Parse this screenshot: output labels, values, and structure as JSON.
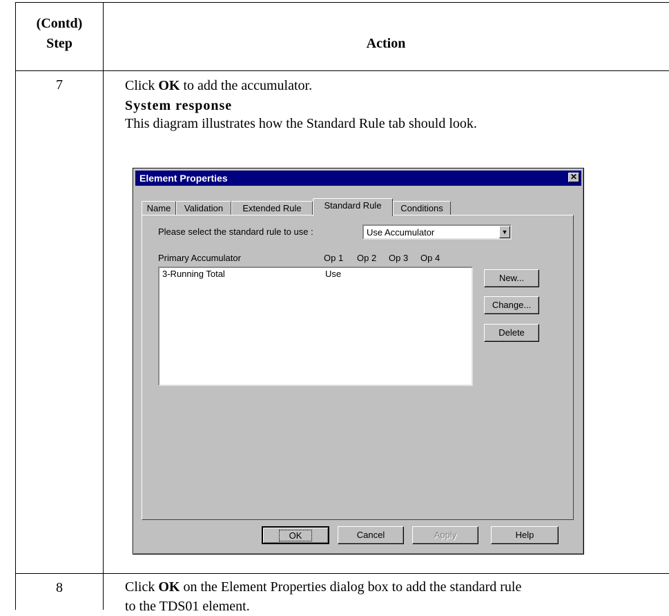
{
  "header": {
    "step_line1": "(Contd)",
    "step_line2": "Step",
    "action": "Action"
  },
  "rows": [
    {
      "step": "7",
      "instruction_pre": "Click ",
      "instruction_bold": "OK",
      "instruction_post": " to add the accumulator.",
      "response_heading": "System response",
      "response_text": "This diagram illustrates how the Standard Rule tab should look."
    },
    {
      "step": "8",
      "instruction_pre": "Click ",
      "instruction_bold": "OK",
      "instruction_post": " on the Element Properties dialog box to add the standard rule",
      "instruction_line2": "to the TDS01 element."
    }
  ],
  "dialog": {
    "title": "Element Properties",
    "close_glyph": "✕",
    "tabs": [
      "Name",
      "Validation",
      "Extended Rule",
      "Standard Rule",
      "Conditions"
    ],
    "active_tab": "Standard Rule",
    "select_label": "Please select the standard rule to use :",
    "rule_value": "Use Accumulator",
    "dropdown_glyph": "▼",
    "columns": [
      "Primary Accumulator",
      "Op 1",
      "Op 2",
      "Op 3",
      "Op 4"
    ],
    "accumulators": [
      {
        "name": "3-Running Total",
        "op1": "Use"
      }
    ],
    "side_buttons": [
      "New...",
      "Change...",
      "Delete"
    ],
    "footer_buttons": [
      "OK",
      "Cancel",
      "Apply",
      "Help"
    ]
  }
}
